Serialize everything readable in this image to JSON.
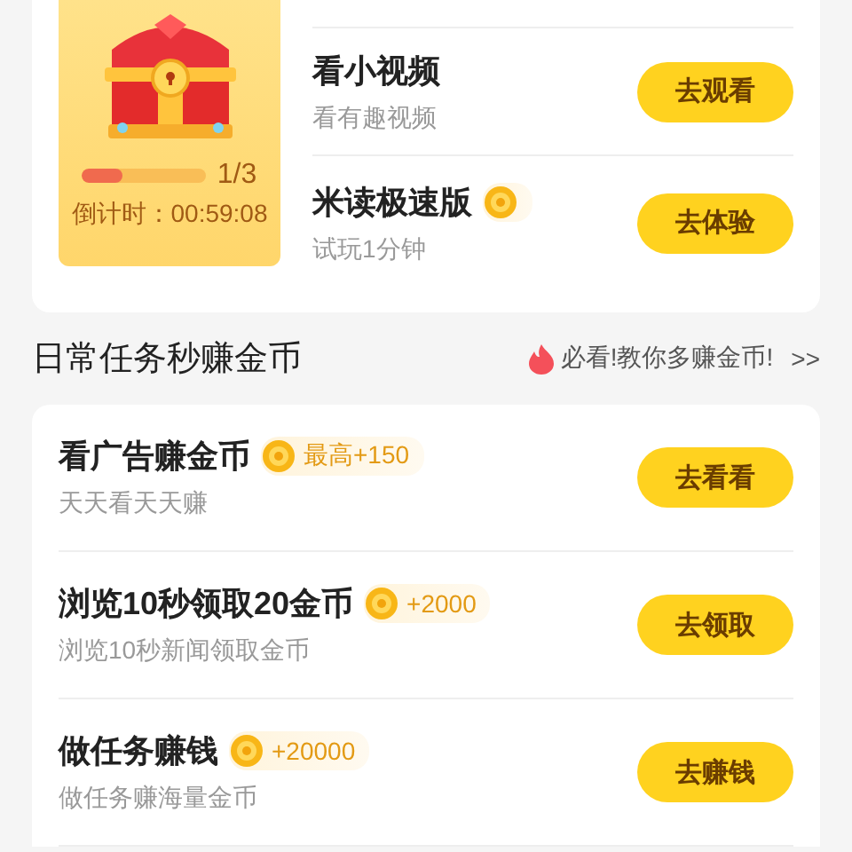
{
  "featured": {
    "progress": {
      "level": 0.33,
      "reading": "1/3"
    },
    "countdown": "倒计时：00:59:08",
    "tasks": [
      {
        "title": "看小视频",
        "subtitle": "看有趣视频",
        "button": "去观看",
        "coin": false
      },
      {
        "title": "米读极速版",
        "subtitle": "试玩1分钟",
        "button": "去体验",
        "coin": true
      }
    ]
  },
  "daily": {
    "title": "日常任务秒赚金币",
    "link": "必看!教你多赚金币!",
    "more": ">>",
    "tasks": [
      {
        "title": "看广告赚金币",
        "reward": "最高+150",
        "subtitle": "天天看天天赚",
        "button": "去看看"
      },
      {
        "title": "浏览10秒领取20金币",
        "reward": "+2000",
        "subtitle": "浏览10秒新闻领取金币",
        "button": "去领取"
      },
      {
        "title": "做任务赚钱",
        "reward": "+20000",
        "subtitle": "做任务赚海量金币",
        "button": "去赚钱"
      }
    ]
  }
}
